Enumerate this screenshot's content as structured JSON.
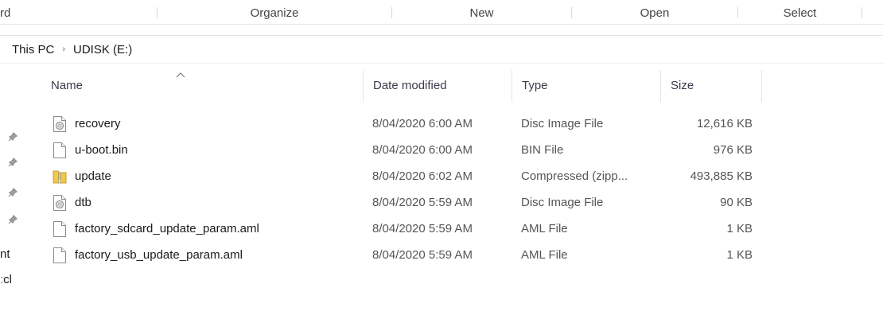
{
  "ribbon": {
    "groups": [
      "rd",
      "Organize",
      "New",
      "Open",
      "Select"
    ]
  },
  "address": {
    "crumbs": [
      "This PC",
      "UDISK (E:)"
    ]
  },
  "nav_pane": {
    "labels": [
      "nt",
      "ːcl"
    ]
  },
  "columns": {
    "name": "Name",
    "date": "Date modified",
    "type": "Type",
    "size": "Size"
  },
  "files": [
    {
      "name": "recovery",
      "date": "8/04/2020 6:00 AM",
      "type": "Disc Image File",
      "size": "12,616 KB",
      "icon": "disc-image-icon"
    },
    {
      "name": "u-boot.bin",
      "date": "8/04/2020 6:00 AM",
      "type": "BIN File",
      "size": "976 KB",
      "icon": "blank-file-icon"
    },
    {
      "name": "update",
      "date": "8/04/2020 6:02 AM",
      "type": "Compressed (zipp...",
      "size": "493,885 KB",
      "icon": "zip-folder-icon"
    },
    {
      "name": "dtb",
      "date": "8/04/2020 5:59 AM",
      "type": "Disc Image File",
      "size": "90 KB",
      "icon": "disc-image-icon"
    },
    {
      "name": "factory_sdcard_update_param.aml",
      "date": "8/04/2020 5:59 AM",
      "type": "AML File",
      "size": "1 KB",
      "icon": "blank-file-icon"
    },
    {
      "name": "factory_usb_update_param.aml",
      "date": "8/04/2020 5:59 AM",
      "type": "AML File",
      "size": "1 KB",
      "icon": "blank-file-icon"
    }
  ],
  "colors": {
    "header_text": "#3a3a4d",
    "meta_text": "#555555",
    "zip_yellow": "#f2c84b"
  }
}
